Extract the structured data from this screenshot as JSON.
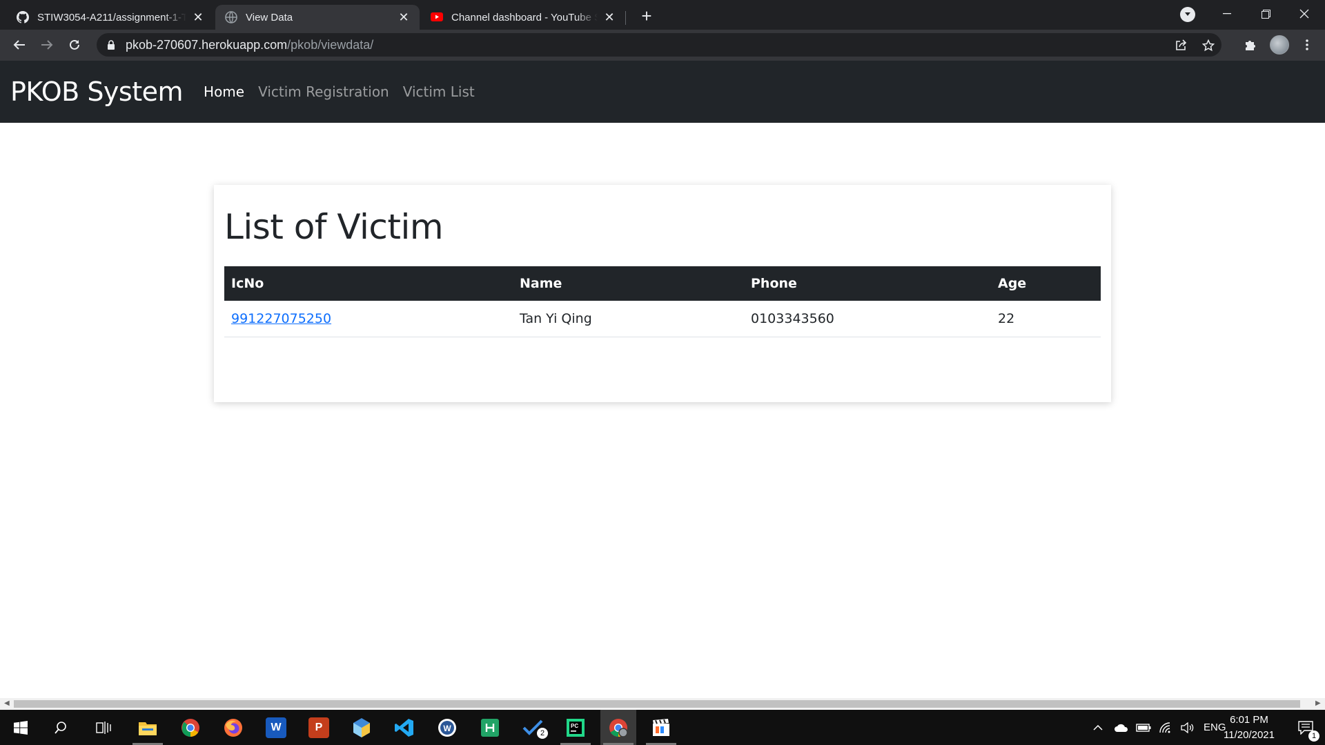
{
  "browser": {
    "tabs": [
      {
        "title": "STIW3054-A211/assignment-1-T",
        "icon": "github-icon",
        "active": false
      },
      {
        "title": "View Data",
        "icon": "globe-icon",
        "active": true
      },
      {
        "title": "Channel dashboard - YouTube St",
        "icon": "youtube-icon",
        "active": false
      }
    ],
    "new_tab_label": "+",
    "url": {
      "host": "pkob-270607.herokuapp.com",
      "path": "/pkob/viewdata/"
    }
  },
  "site": {
    "brand": "PKOB System",
    "nav": [
      {
        "label": "Home",
        "active": true
      },
      {
        "label": "Victim Registration",
        "active": false
      },
      {
        "label": "Victim List",
        "active": false
      }
    ]
  },
  "main": {
    "title": "List of Victim",
    "table": {
      "columns": [
        "IcNo",
        "Name",
        "Phone",
        "Age"
      ],
      "rows": [
        {
          "icno": "991227075250",
          "name": "Tan Yi Qing",
          "phone": "0103343560",
          "age": "22"
        }
      ]
    }
  },
  "taskbar": {
    "apps": [
      "windows-start-icon",
      "search-icon",
      "task-view-icon",
      "file-explorer-icon",
      "chrome-icon",
      "firefox-icon",
      "word-icon",
      "powerpoint-icon",
      "virtualbox-icon",
      "vscode-icon",
      "wps-icon",
      "sheets-icon",
      "todo-icon",
      "pycharm-icon",
      "chrome-profile-icon",
      "movie-maker-icon"
    ],
    "todo_badge": "2",
    "language": "ENG",
    "time": "6:01 PM",
    "date": "11/20/2021",
    "notification_count": "1"
  },
  "colors": {
    "navbar_bg": "#212529",
    "table_header_bg": "#212529",
    "link": "#0d6efd",
    "chrome_frame": "#202124",
    "chrome_toolbar": "#35363a"
  }
}
